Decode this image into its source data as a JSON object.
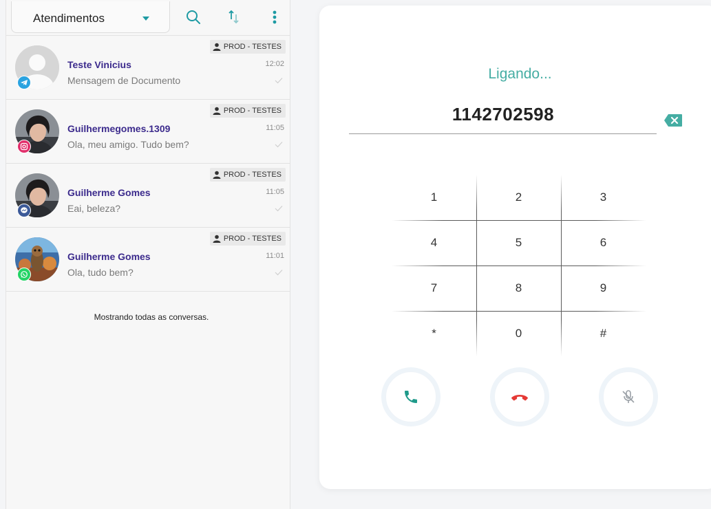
{
  "topbar": {
    "department": "Atendimentos",
    "icons": [
      "search-icon",
      "sort-icon",
      "more-vertical-icon"
    ]
  },
  "conversations": [
    {
      "name": "Teste Vinicius",
      "message": "Mensagem de Documento",
      "badge": "PROD - TESTES",
      "time": "12:02",
      "channel": "telegram",
      "channel_color": "#2aa3e0",
      "avatar": "default"
    },
    {
      "name": "Guilhermegomes.1309",
      "message": "Ola, meu amigo. Tudo bem?",
      "badge": "PROD - TESTES",
      "time": "11:05",
      "channel": "instagram",
      "channel_color": "#e1306c",
      "avatar": "photo"
    },
    {
      "name": "Guilherme Gomes",
      "message": "Eai, beleza?",
      "badge": "PROD - TESTES",
      "time": "11:05",
      "channel": "messenger",
      "channel_color": "#3b5998",
      "avatar": "photo"
    },
    {
      "name": "Guilherme Gomes",
      "message": "Ola, tudo bem?",
      "badge": "PROD - TESTES",
      "time": "11:01",
      "channel": "whatsapp",
      "channel_color": "#25d366",
      "avatar": "poster"
    }
  ],
  "list_footer": "Mostrando todas as conversas.",
  "dialer": {
    "status": "Ligando...",
    "number": "1142702598",
    "keys": [
      "1",
      "2",
      "3",
      "4",
      "5",
      "6",
      "7",
      "8",
      "9",
      "*",
      "0",
      "#"
    ],
    "buttons": [
      "phone-call-icon",
      "hang-up-icon",
      "mic-off-icon"
    ]
  },
  "colors": {
    "accent": "#45ada3",
    "name": "#3b2a8c",
    "call_green": "#1f9a8a",
    "hangup_red": "#e53935"
  }
}
